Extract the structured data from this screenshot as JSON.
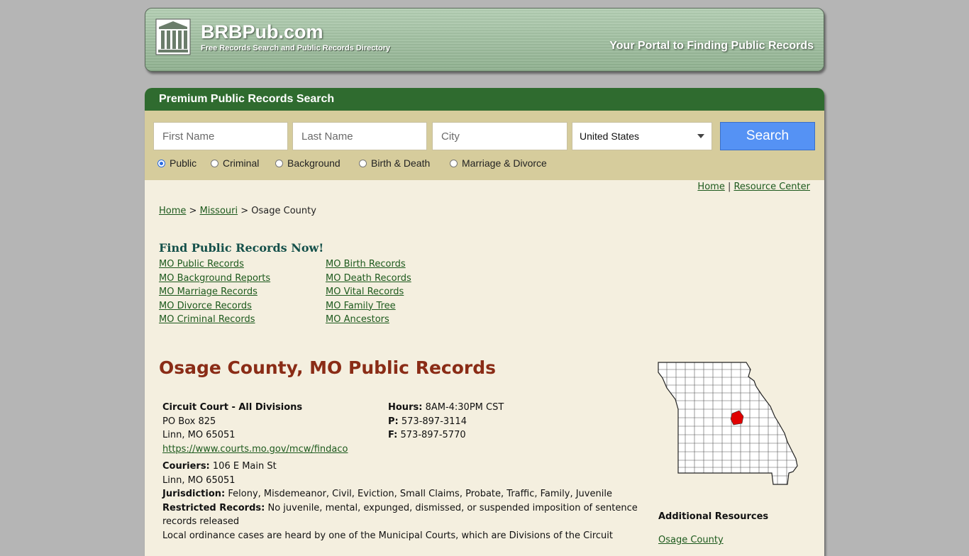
{
  "header": {
    "brand": "BRBPub.com",
    "tagline": "Free Records Search and Public Records Directory",
    "portal": "Your Portal to Finding Public Records"
  },
  "search": {
    "title": "Premium Public Records Search",
    "first_placeholder": "First Name",
    "last_placeholder": "Last Name",
    "city_placeholder": "City",
    "country": "United States",
    "button": "Search",
    "types": [
      {
        "label": "Public",
        "selected": true
      },
      {
        "label": "Criminal",
        "selected": false
      },
      {
        "label": "Background",
        "selected": false
      },
      {
        "label": "Birth & Death",
        "selected": false
      },
      {
        "label": "Marriage & Divorce",
        "selected": false
      }
    ]
  },
  "topnav": {
    "home": "Home",
    "sep": "|",
    "resource": "Resource Center"
  },
  "breadcrumb": {
    "home": "Home",
    "sep1": ">",
    "state": "Missouri",
    "sep2": ">",
    "current": "Osage County"
  },
  "find": {
    "title": "Find Public Records Now!",
    "col1": [
      "MO Public Records",
      "MO Background Reports",
      "MO Marriage Records",
      "MO Divorce Records",
      "MO Criminal Records"
    ],
    "col2": [
      "MO Birth Records",
      "MO Death Records",
      "MO Vital Records",
      "MO Family Tree",
      "MO Ancestors"
    ]
  },
  "county": {
    "title": "Osage County, MO Public Records",
    "court_name": "Circuit Court - All Divisions",
    "address1": "PO Box 825",
    "address2": "Linn, MO 65051",
    "url": "https://www.courts.mo.gov/mcw/findaco",
    "hours_label": "Hours:",
    "hours": "8AM-4:30PM CST",
    "phone_label": "P:",
    "phone": "573-897-3114",
    "fax_label": "F:",
    "fax": "573-897-5770",
    "couriers_label": "Couriers:",
    "couriers": "106 E Main St",
    "couriers2": "Linn, MO 65051",
    "jurisdiction_label": "Jurisdiction:",
    "jurisdiction": "Felony, Misdemeanor, Civil, Eviction, Small Claims, Probate, Traffic, Family, Juvenile",
    "restricted_label": "Restricted Records:",
    "restricted": "No juvenile, mental, expunged, dismissed, or suspended imposition of sentence",
    "restricted2": "records released",
    "note": "Local ordinance cases are heard by one of the Municipal Courts, which are Divisions of the Circuit"
  },
  "sidebar": {
    "title": "Additional Resources",
    "link": "Osage County"
  },
  "colors": {
    "header_green": "#2f6b2f",
    "search_bg": "#d6cc9c",
    "title_red": "#8a2c16",
    "button_blue": "#5592f4",
    "map_highlight": "#e00000"
  }
}
